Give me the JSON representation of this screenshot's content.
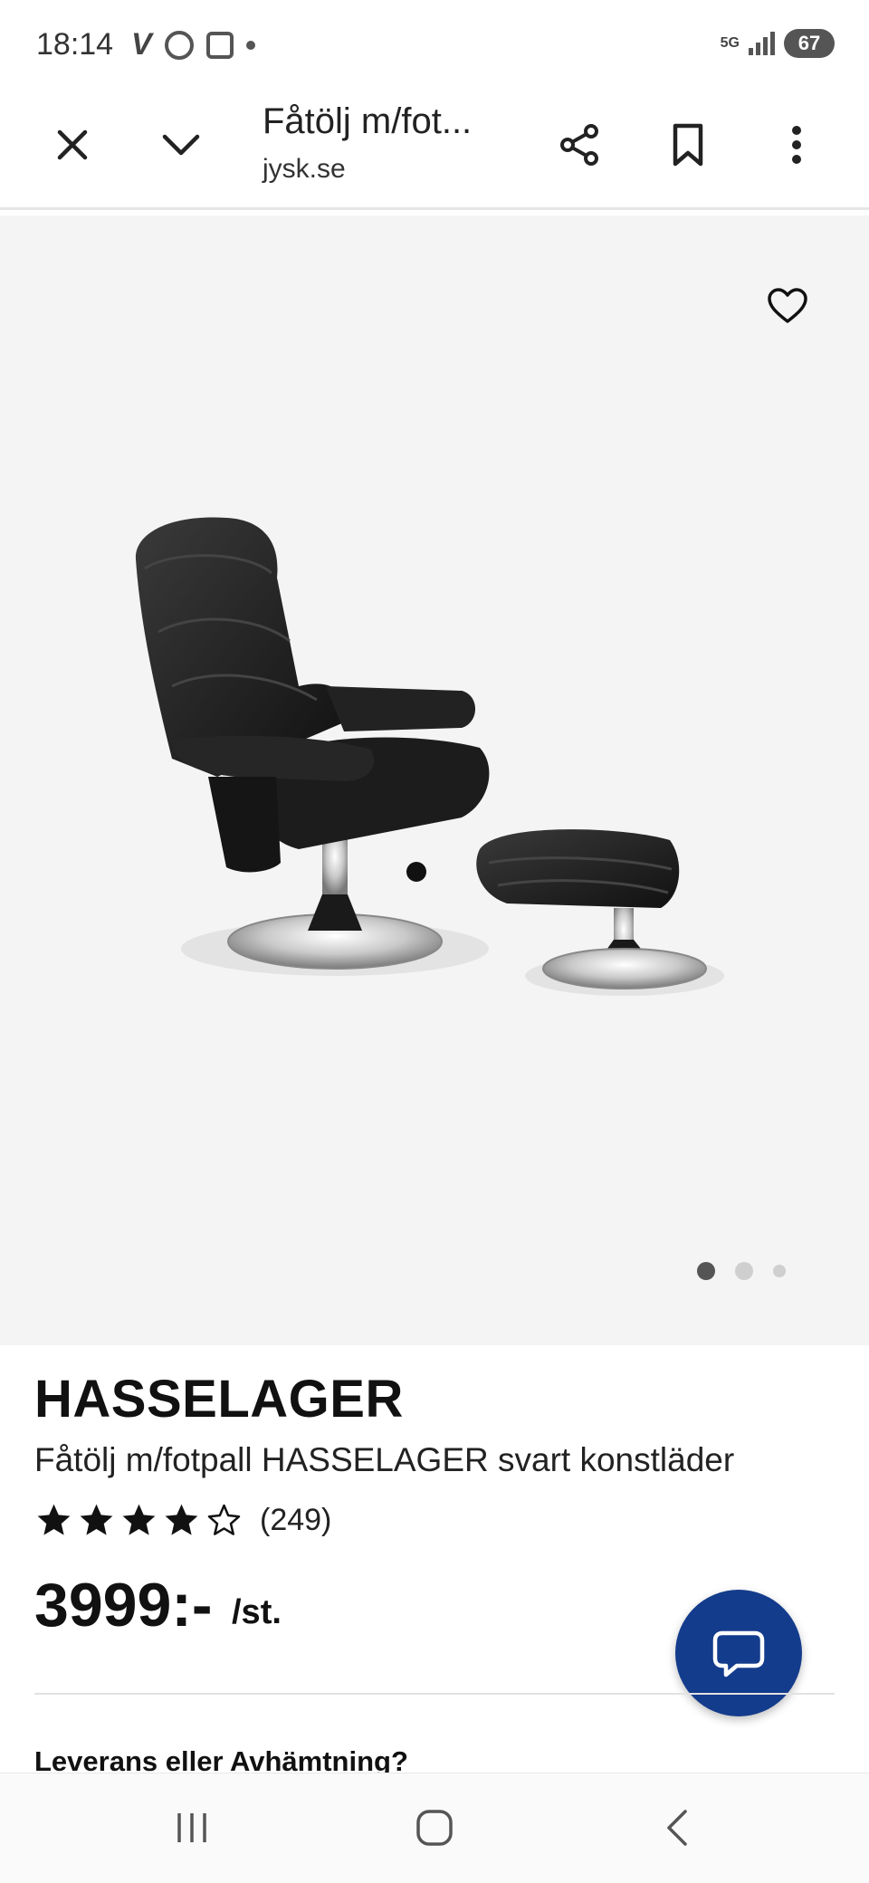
{
  "status_bar": {
    "time": "18:14",
    "network": "5G",
    "battery": "67"
  },
  "browser": {
    "page_title": "Fåtölj m/fot...",
    "url": "jysk.se",
    "close_icon": "close-icon",
    "collapse_icon": "chevron-down-icon",
    "share_icon": "share-icon",
    "bookmark_icon": "bookmark-icon",
    "more_icon": "more-vert-icon"
  },
  "gallery": {
    "favorite_icon": "heart-icon",
    "image_alt": "Fåtölj m/fotpall HASSELAGER svart konstläder",
    "active_slide": 1,
    "slide_count": 3
  },
  "product": {
    "brand": "HASSELAGER",
    "name": "Fåtölj m/fotpall HASSELAGER svart konstläder",
    "rating": 4,
    "rating_max": 5,
    "review_count": "(249)",
    "price": "3999:-",
    "price_unit": "/st."
  },
  "delivery": {
    "heading": "Leverans eller Avhämtning?"
  },
  "chat": {
    "icon": "chat-bubble-icon"
  },
  "colors": {
    "accent": "#143c8c",
    "gallery_bg": "#f4f4f4",
    "text": "#111111"
  }
}
